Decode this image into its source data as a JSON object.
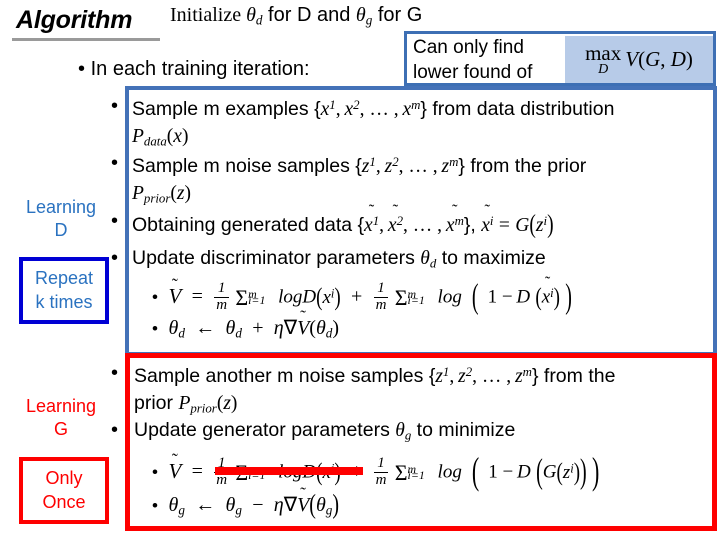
{
  "slide": {
    "title": "Algorithm",
    "colors": {
      "blue_border": "#4472b8",
      "red_border": "#fe0000",
      "blue_text": "#2a72c0",
      "red_text": "#fe0000",
      "callout_border": "#3d6fb4",
      "formula_highlight": "#b7cbe8",
      "title_rule": "#9a9a9a"
    },
    "header": {
      "initialize_line": "Initialize θ_d for D and θ_g for G",
      "iteration_line": "In each training iteration:"
    },
    "callout": {
      "text_line_1": "Can only find",
      "text_line_2": "lower found of",
      "formula": "max_D V(G, D)",
      "formula_operator": "max",
      "formula_limit": "D",
      "formula_body": "V(G, D)"
    },
    "learning_d": {
      "label_line_1": "Learning",
      "label_line_2": "D",
      "box_line_1": "Repeat",
      "box_line_2": "k times",
      "steps": [
        "Sample m examples {x¹, x², … , xᵐ} from data distribution P_data(x)",
        "Sample m noise samples {z¹, z², … , zᵐ} from the prior P_prior(z)",
        "Obtaining generated data {x̃¹, x̃², … , x̃ᵐ}, x̃ⁱ = G(zⁱ)",
        "Update discriminator parameters θ_d to maximize"
      ],
      "formulas": [
        "Ṽ = 1/m Σᵢ₌₁ᵐ logD(xⁱ) + 1/m Σᵢ₌₁ᵐ log(1 − D(x̃ⁱ))",
        "θ_d ← θ_d + η∇Ṽ(θ_d)"
      ]
    },
    "learning_g": {
      "label_line_1": "Learning",
      "label_line_2": "G",
      "box_line_1": "Only",
      "box_line_2": "Once",
      "steps": [
        "Sample another m noise samples {z¹, z², … , zᵐ} from the prior P_prior(z)",
        "Update generator parameters θ_g to minimize"
      ],
      "formulas": [
        "Ṽ = 1/m Σᵢ₌₁ᵐ logD(xⁱ) [struck through] + 1/m Σᵢ₌₁ᵐ log(1 − D(G(zⁱ)))",
        "θ_g ← θ_g − η∇Ṽ(θ_g)"
      ]
    },
    "glyphs": {
      "bullet": "•",
      "bullet_small": "•"
    }
  }
}
